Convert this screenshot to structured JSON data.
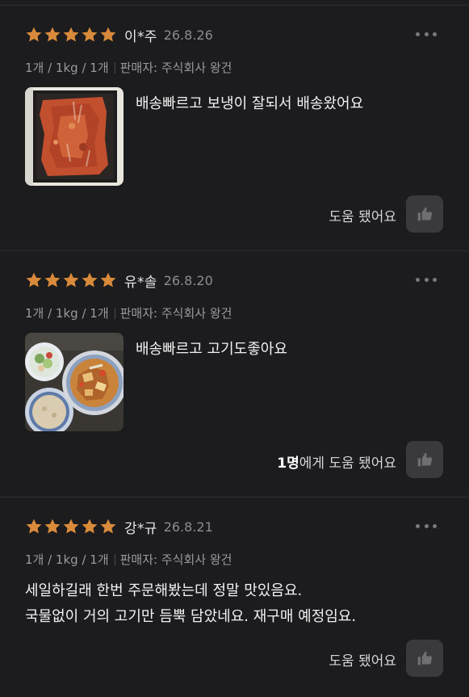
{
  "reviews": [
    {
      "stars": 5,
      "author": "이*주",
      "date": "26.8.26",
      "option": "1개 / 1kg / 1개",
      "seller": "판매자: 주식회사 왕건",
      "text": "배송빠르고 보냉이 잘되서 배송왔어요",
      "photo": "packaged-marinated-meat",
      "helpful_count": "",
      "helpful_label": "도움 됐어요"
    },
    {
      "stars": 5,
      "author": "유*솔",
      "date": "26.8.20",
      "option": "1개 / 1kg / 1개",
      "seller": "판매자: 주식회사 왕건",
      "text": "배송빠르고 고기도좋아요",
      "photo": "cooked-meal-with-rice-and-salad",
      "helpful_count": "1명",
      "helpful_label": "에게 도움 됐어요"
    },
    {
      "stars": 5,
      "author": "강*규",
      "date": "26.8.21",
      "option": "1개 / 1kg / 1개",
      "seller": "판매자: 주식회사 왕건",
      "text_line1": "세일하길래 한번 주문해봤는데 정말 맛있음요.",
      "text_line2": "국물없이 거의 고기만 듬뿍 담았네요. 재구매 예정임요.",
      "helpful_count": "",
      "helpful_label": "도움 됐어요"
    }
  ],
  "colors": {
    "background": "#1c1c1e",
    "star": "#d98a3a",
    "button": "#3a3a3d"
  }
}
